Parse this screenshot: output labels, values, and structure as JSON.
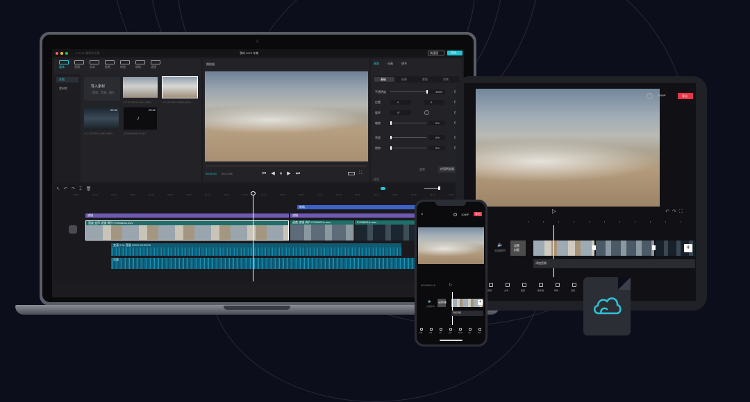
{
  "colors": {
    "accent": "#25c5d8",
    "record": "#e8344a",
    "background": "#0d0e1c"
  },
  "laptop": {
    "title": "我的 2020 年集",
    "titlebar_left": "0:00:00  剪映专业版",
    "btn_shortcut": "快捷键",
    "btn_export": "导出",
    "media_tabs": [
      "媒体",
      "音频",
      "文本",
      "贴纸",
      "特效",
      "转场",
      "滤镜"
    ],
    "media_left": {
      "local": "本地",
      "library": "素材库"
    },
    "import_label": "导入素材",
    "import_sub": "视频、音频、图片",
    "media_items": [
      {
        "name": "YC-STORYLINE1.MP4",
        "duration": ""
      },
      {
        "name": "YC-STORYLINE2.MP4",
        "duration": ""
      },
      {
        "name": "YC-STORYLINE3.MP4",
        "duration": "00:32"
      },
      {
        "name": "STUNNING.FLAC",
        "duration": "00:32"
      }
    ],
    "player_title": "播放器",
    "time_current": "00:00:40",
    "time_total": "00:27:08",
    "inspector_tabs": [
      "画面",
      "动画",
      "调节"
    ],
    "sub_tabs": [
      "基础",
      "抠像",
      "蒙版",
      "背景"
    ],
    "props": [
      {
        "label": "不透明度",
        "value": "100%"
      },
      {
        "label": "位置",
        "x": "0",
        "y": "0"
      },
      {
        "label": "旋转",
        "value": "0°"
      },
      {
        "label": "缩放",
        "value": "0%"
      },
      {
        "label": "亮度",
        "value": "0%"
      },
      {
        "label": "饱和",
        "value": "0%"
      }
    ],
    "btn_reset": "重置",
    "btn_apply_all": "应用到全部",
    "inspector_footer": "混合",
    "ruler": [
      "00:00",
      "00:10",
      "00:20",
      "00:30",
      "00:40",
      "00:50",
      "01:00",
      "01:10",
      "01:20",
      "01:30",
      "01:40",
      "01:50",
      "02:00",
      "02:10",
      "02:20",
      "02:30",
      "02:40",
      "02:50",
      "03:00",
      "03:10",
      "03:20"
    ],
    "track_labels": {
      "filter1": "滤镜",
      "filter2": "转场",
      "clip1": "速度 变声 滤镜 调节  FVS9821A.mov",
      "clip2": "速度 滤镜 调节  FVS9821A.mov",
      "clip3": "FVS9821A.mov",
      "audio1": "变速 2.0x  音量 100%  00:03:00",
      "audio2": "音频"
    }
  },
  "tablet": {
    "resolution": "1080P",
    "export": "导出",
    "add_audio": "添加音频",
    "cover_line1": "设置",
    "cover_line2": "封面",
    "mute": "关闭原声",
    "toolbar": [
      "音频",
      "文本",
      "贴纸",
      "画中画",
      "特效",
      "滤镜",
      "比例",
      "背景",
      "调节"
    ]
  },
  "phone": {
    "resolution": "1080P",
    "export": "导出",
    "time": "00:00/00:16",
    "add_audio": "添加音频",
    "cover": "设置封面",
    "mute": "关闭原声",
    "toolbar": [
      "剪辑",
      "音频",
      "文本",
      "贴纸",
      "画中画",
      "特效",
      "滤镜"
    ]
  },
  "icons": [
    "play-icon",
    "pause-icon",
    "skip-back-icon",
    "skip-forward-icon",
    "undo-icon",
    "redo-icon",
    "fullscreen-icon",
    "help-icon",
    "close-icon",
    "plus-icon",
    "cloud-icon",
    "split-icon",
    "delete-icon",
    "music-icon",
    "speaker-icon"
  ]
}
